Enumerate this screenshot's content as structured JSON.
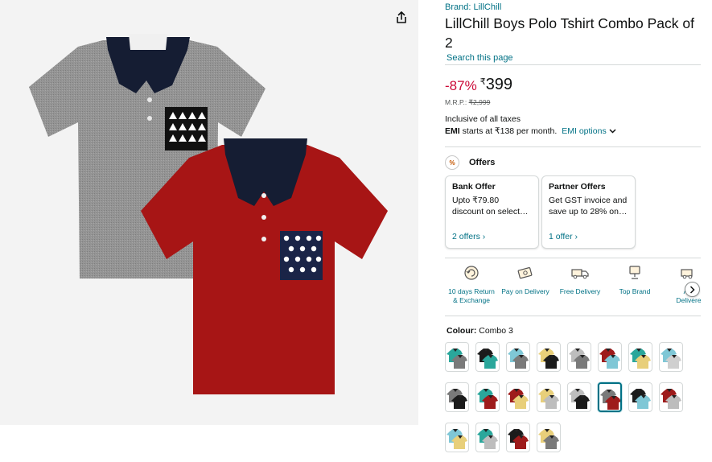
{
  "product": {
    "brand_label": "Brand: LillChill",
    "title": "LillChill Boys Polo Tshirt Combo Pack of 2",
    "search_link": "Search this page"
  },
  "pricing": {
    "discount": "-87%",
    "currency": "₹",
    "price": "399",
    "mrp_label": "M.R.P.:",
    "mrp_value": "₹2,999",
    "taxes": "Inclusive of all taxes",
    "emi_bold": "EMI",
    "emi_text": "starts at ₹138 per month.",
    "emi_link": "EMI options"
  },
  "offers": {
    "title": "Offers",
    "icon_text": "%",
    "cards": [
      {
        "title": "Bank Offer",
        "desc1": "Upto ₹79.80",
        "desc2": "discount on select…",
        "link": "2 offers ›"
      },
      {
        "title": "Partner Offers",
        "desc1": "Get GST invoice and",
        "desc2": "save up to 28% on…",
        "link": "1 offer ›"
      }
    ]
  },
  "features": [
    {
      "line1": "10 days Return",
      "line2": "& Exchange",
      "icon": "return-icon"
    },
    {
      "line1": "Pay on Delivery",
      "line2": "",
      "icon": "cash-icon"
    },
    {
      "line1": "Free Delivery",
      "line2": "",
      "icon": "truck-icon"
    },
    {
      "line1": "Top Brand",
      "line2": "",
      "icon": "trophy-icon"
    },
    {
      "line1": "Am",
      "line2": "Delivere",
      "icon": "delivery-icon"
    }
  ],
  "colour": {
    "label": "Colour:",
    "selected": "Combo 3",
    "swatches": [
      {
        "back": "#2aa79b",
        "front": "#7a7a7a"
      },
      {
        "back": "#1b1b1b",
        "front": "#2aa79b"
      },
      {
        "back": "#7fc7d6",
        "front": "#7a7a7a"
      },
      {
        "back": "#e8cf7a",
        "front": "#1b1b1b"
      },
      {
        "back": "#bdbdbd",
        "front": "#7a7a7a"
      },
      {
        "back": "#9e1b1b",
        "front": "#7fc7d6"
      },
      {
        "back": "#2aa79b",
        "front": "#e8cf7a"
      },
      {
        "back": "#7fc7d6",
        "front": "#cfcfcf"
      },
      {
        "back": "#7a7a7a",
        "front": "#1b1b1b"
      },
      {
        "back": "#2aa79b",
        "front": "#9e1b1b"
      },
      {
        "back": "#9e1b1b",
        "front": "#e8cf7a"
      },
      {
        "back": "#e8cf7a",
        "front": "#bdbdbd"
      },
      {
        "back": "#bdbdbd",
        "front": "#1b1b1b"
      },
      {
        "back": "#7a7a7a",
        "front": "#9e1b1b"
      },
      {
        "back": "#1b1b1b",
        "front": "#7fc7d6"
      },
      {
        "back": "#9e1b1b",
        "front": "#bdbdbd"
      },
      {
        "back": "#7fc7d6",
        "front": "#e8cf7a"
      },
      {
        "back": "#2aa79b",
        "front": "#bdbdbd"
      },
      {
        "back": "#1b1b1b",
        "front": "#9e1b1b"
      },
      {
        "back": "#e8cf7a",
        "front": "#7a7a7a"
      }
    ],
    "selected_index": 13
  },
  "colors": {
    "link": "#007185",
    "discount": "#cc0c39",
    "shirt_grey": "#8f8f8f",
    "shirt_red": "#a71515",
    "collar": "#151d33"
  }
}
